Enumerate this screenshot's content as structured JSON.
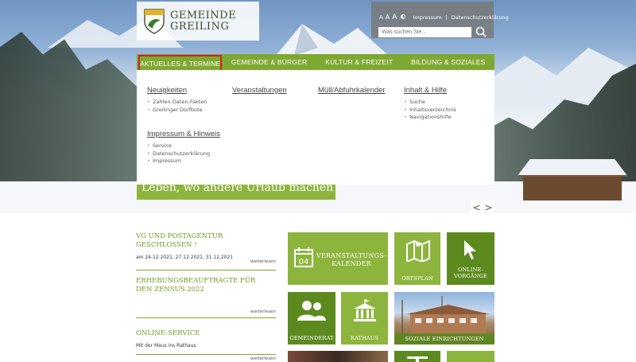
{
  "logo": {
    "line1": "GEMEINDE",
    "line2": "GREILING"
  },
  "tools": {
    "font_small": "A",
    "font_medium": "A",
    "font_large": "A",
    "impressum": "Impressum",
    "separator": "|",
    "datenschutz": "Datenschutzerklärung",
    "search_placeholder": "Was suchen Sie..."
  },
  "nav": {
    "items": [
      {
        "label": "AKTUELLES & TERMINE"
      },
      {
        "label": "GEMEINDE & BÜRGER"
      },
      {
        "label": "KULTUR & FREIZEIT"
      },
      {
        "label": "BILDUNG & SOZIALES"
      }
    ]
  },
  "dropdown": {
    "columns": [
      {
        "heading": "Neuigkeiten",
        "items": [
          "Zahlen-Daten-Fakten",
          "Greilinger Dorfbote"
        ]
      },
      {
        "heading": "Veranstaltungen",
        "items": []
      },
      {
        "heading": "Müll/Abfuhrkalender",
        "items": []
      },
      {
        "heading": "Inhalt & Hilfe",
        "items": [
          "Suche",
          "Inhaltsverzeichnis",
          "Navigationshilfe"
        ]
      },
      {
        "heading": "Impressum & Hinweis",
        "items": [
          "Service",
          "Datenschutzerklärung",
          "Impressum"
        ]
      }
    ]
  },
  "slogan": "Leben, wo andere Urlaub machen",
  "slider": {
    "prev": "<",
    "next": ">"
  },
  "news": [
    {
      "title": "VG UND POSTAGENTUR GESCHLOSSEN !",
      "sub": "am 24.12.2021, 27.12.2021, 31.12.2021",
      "more": "weiterlesen"
    },
    {
      "title": "ERHEBUNGSBEAUFTRAGTE FÜR DEN ZENSUS 2022",
      "sub": "",
      "more": "weiterlesen"
    },
    {
      "title": "ONLINE-SERVICE",
      "sub": "Mit der Maus ins Rathaus",
      "more": "weiterlesen"
    }
  ],
  "tiles": {
    "calendar_day": "04",
    "veranstaltungskalender": "VERANSTALTUNGS-\nKALENDER",
    "ortsplan": "ORTSPLAN",
    "online_vorgaenge": "ONLINE-\nVORGÄNGE",
    "gemeinderat": "GEMEINDERAT",
    "rathaus": "RATHAUS",
    "soziale": "SOZIALE EINRICHTUNGEN"
  },
  "colors": {
    "brand_green": "#7fa832",
    "dark_green": "#5c8a1e",
    "active_outline": "#d0222a"
  }
}
